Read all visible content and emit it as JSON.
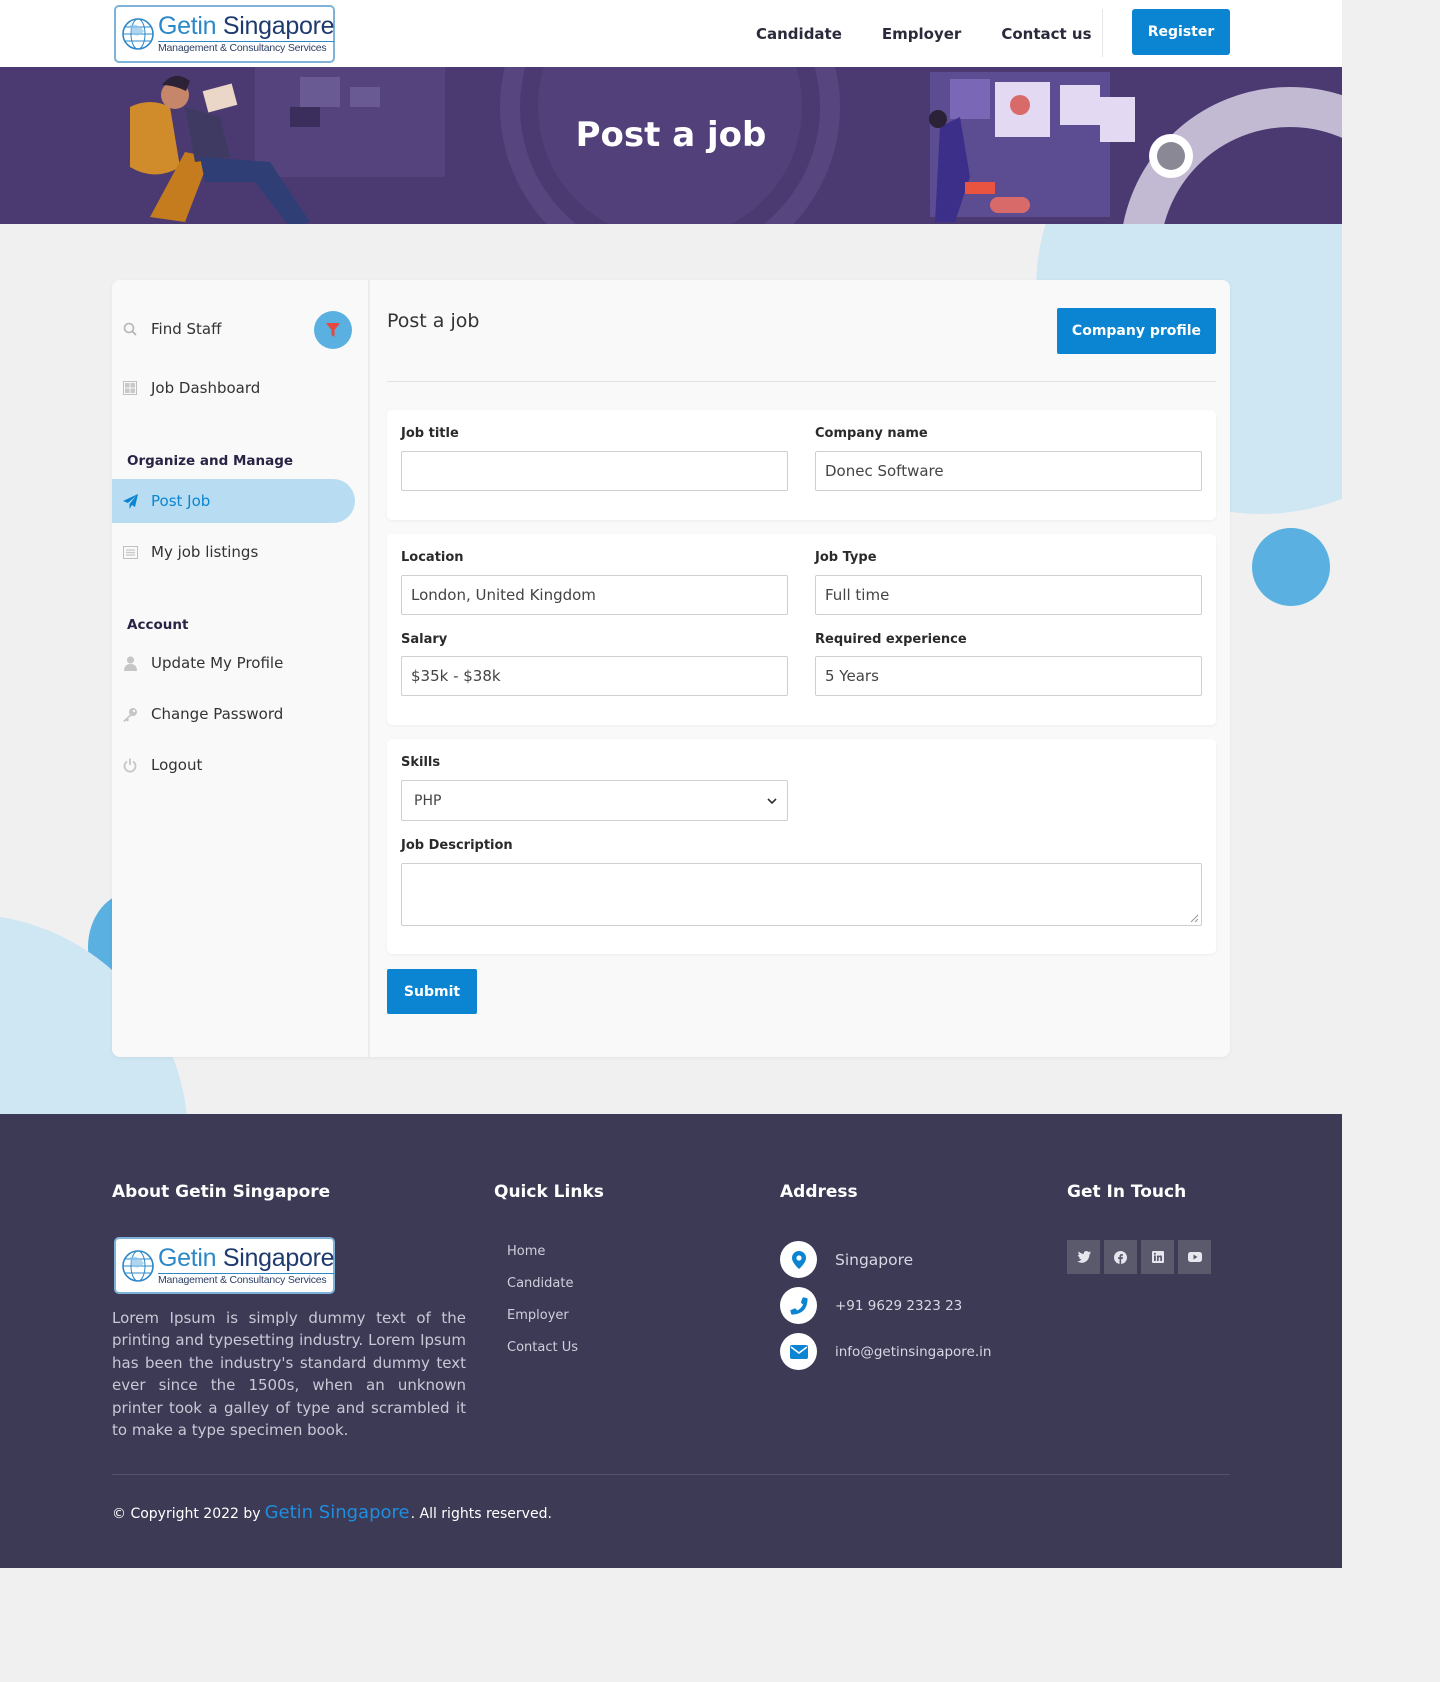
{
  "header": {
    "logo": {
      "brand_part1": "Getin",
      "brand_part2": "Singapore",
      "tagline": "Management & Consultancy Services"
    },
    "nav": [
      "Candidate",
      "Employer",
      "Contact us"
    ],
    "register_label": "Register"
  },
  "banner": {
    "title": "Post a job"
  },
  "sidebar": {
    "top_items": [
      {
        "label": "Find Staff",
        "icon": "search-icon"
      },
      {
        "label": "Job Dashboard",
        "icon": "dashboard-icon"
      }
    ],
    "filter_icon": "filter-icon",
    "section_organize": "Organize and Manage",
    "organize_items": [
      {
        "label": "Post Job",
        "icon": "paper-plane-icon",
        "active": true
      },
      {
        "label": "My job listings",
        "icon": "list-icon"
      }
    ],
    "section_account": "Account",
    "account_items": [
      {
        "label": "Update My Profile",
        "icon": "user-icon"
      },
      {
        "label": "Change Password",
        "icon": "key-icon"
      },
      {
        "label": "Logout",
        "icon": "power-icon"
      }
    ]
  },
  "main": {
    "title": "Post a job",
    "company_profile_label": "Company profile",
    "form": {
      "job_title": {
        "label": "Job title",
        "value": ""
      },
      "company_name": {
        "label": "Company name",
        "value": "Donec Software"
      },
      "location": {
        "label": "Location",
        "value": "London, United Kingdom"
      },
      "job_type": {
        "label": "Job Type",
        "value": "Full time"
      },
      "salary": {
        "label": "Salary",
        "value": "$35k - $38k"
      },
      "experience": {
        "label": "Required experience",
        "value": "5 Years"
      },
      "skills": {
        "label": "Skills",
        "selected": "PHP"
      },
      "description": {
        "label": "Job Description",
        "value": ""
      }
    },
    "submit_label": "Submit"
  },
  "footer": {
    "about": {
      "heading": "About Getin Singapore",
      "text": "Lorem Ipsum is simply dummy text of the printing and typesetting industry. Lorem Ipsum has been the industry's standard dummy text ever since the 1500s, when an unknown printer took a galley of type and scrambled it to make a type specimen book."
    },
    "quick_links": {
      "heading": "Quick Links",
      "items": [
        "Home",
        "Candidate",
        "Employer",
        "Contact Us"
      ]
    },
    "address": {
      "heading": "Address",
      "location": "Singapore",
      "phone": "+91 9629 2323 23",
      "email": "info@getinsingapore.in"
    },
    "get_in_touch": {
      "heading": "Get In Touch",
      "socials": [
        "twitter-icon",
        "facebook-icon",
        "linkedin-icon",
        "youtube-icon"
      ]
    },
    "copyright": {
      "prefix": "© Copyright 2022 by",
      "brand": "Getin Singapore",
      "suffix": ". All rights reserved."
    }
  },
  "colors": {
    "primary": "#0b84d1",
    "banner": "#4b3a72",
    "footer": "#3c3a54",
    "sidebar_active": "#b8ddf2",
    "filter_button": "#5ab0e0",
    "filter_icon": "#e8483f"
  }
}
